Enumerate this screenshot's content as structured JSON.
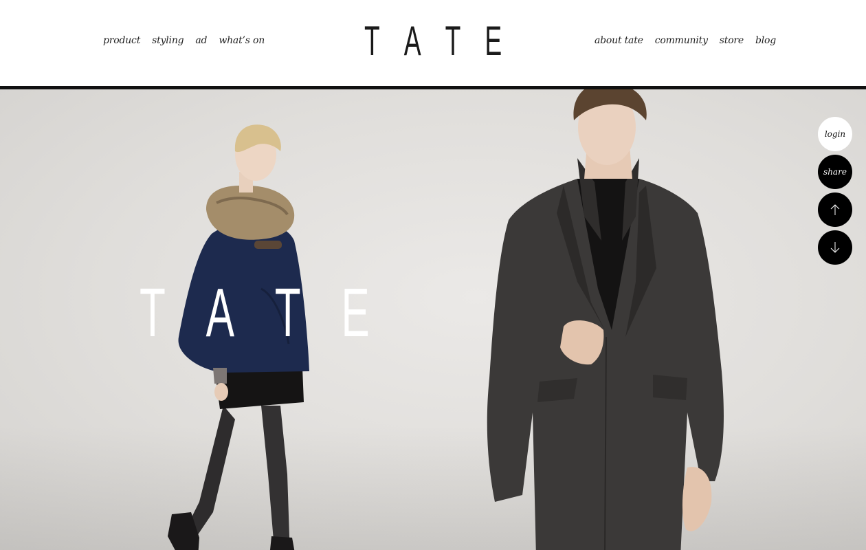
{
  "nav_left": [
    {
      "label": "product"
    },
    {
      "label": "styling"
    },
    {
      "label": "ad"
    },
    {
      "label": "what’s on"
    }
  ],
  "logo": {
    "letters": [
      "T",
      "A",
      "T",
      "E"
    ]
  },
  "nav_right": [
    {
      "label": "about tate"
    },
    {
      "label": "community"
    },
    {
      "label": "store"
    },
    {
      "label": "blog"
    }
  ],
  "hero": {
    "wordmark_letters": [
      "T",
      "A",
      "T",
      "E"
    ]
  },
  "side_buttons": {
    "login": "login",
    "share": "share",
    "up_icon": "arrow-up-icon",
    "down_icon": "arrow-down-icon"
  },
  "colors": {
    "header_bg": "#ffffff",
    "rule": "#111111",
    "button_dark": "#000000",
    "hero_bg": "#e2e0dd"
  }
}
